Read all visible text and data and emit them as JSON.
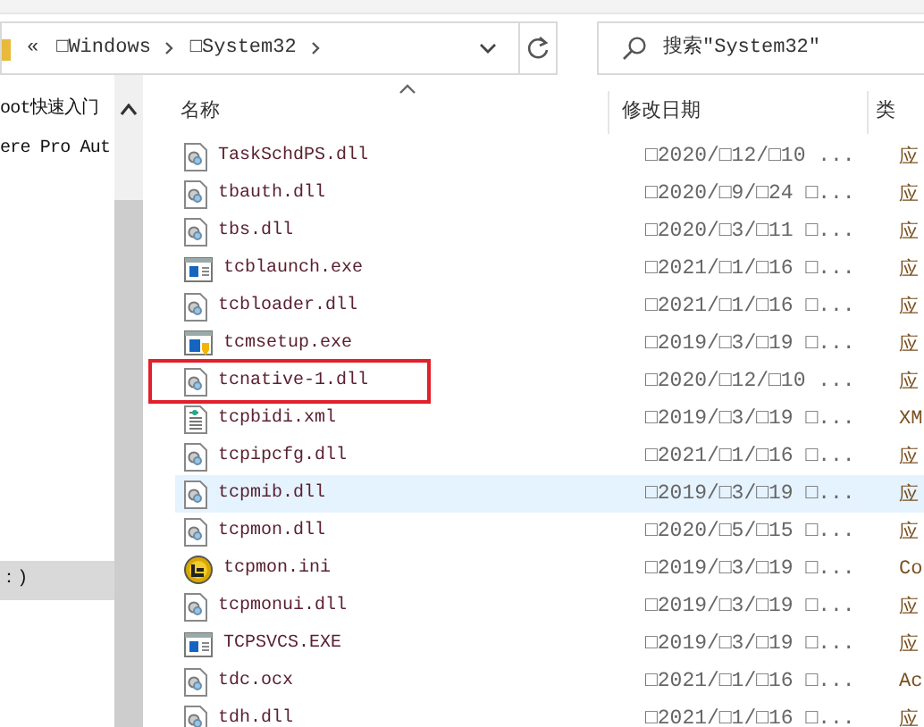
{
  "address_bar": {
    "overflow": "«",
    "segments": [
      "□Windows",
      "□System32"
    ]
  },
  "search": {
    "placeholder": "搜索\"System32\""
  },
  "sidebar": {
    "items": [
      {
        "label": "oot快速入门",
        "selected": false
      },
      {
        "label": "ere Pro Aut",
        "selected": false
      },
      {
        "label": "：)",
        "selected": true
      }
    ]
  },
  "table": {
    "columns": [
      "名称",
      "修改日期",
      "类"
    ],
    "rows": [
      {
        "kind": "dll",
        "name": "TaskSchdPS.dll",
        "date": "□2020/□12/□10 ...",
        "column_3": "应",
        "selected": false,
        "marked": false
      },
      {
        "kind": "dll",
        "name": "tbauth.dll",
        "date": "□2020/□9/□24 □...",
        "column_3": "应",
        "selected": false,
        "marked": false
      },
      {
        "kind": "dll",
        "name": "tbs.dll",
        "date": "□2020/□3/□11 □...",
        "column_3": "应",
        "selected": false,
        "marked": false
      },
      {
        "kind": "exe",
        "name": "tcblaunch.exe",
        "date": "□2021/□1/□16 □...",
        "column_3": "应",
        "selected": false,
        "marked": false
      },
      {
        "kind": "dll",
        "name": "tcbloader.dll",
        "date": "□2021/□1/□16 □...",
        "column_3": "应",
        "selected": false,
        "marked": false
      },
      {
        "kind": "setup",
        "name": "tcmsetup.exe",
        "date": "□2019/□3/□19 □...",
        "column_3": "应",
        "selected": false,
        "marked": false
      },
      {
        "kind": "dll",
        "name": "tcnative-1.dll",
        "date": "□2020/□12/□10 ...",
        "column_3": "应",
        "selected": false,
        "marked": true
      },
      {
        "kind": "xml",
        "name": "tcpbidi.xml",
        "date": "□2019/□3/□19 □...",
        "column_3": "XM",
        "selected": false,
        "marked": false
      },
      {
        "kind": "dll",
        "name": "tcpipcfg.dll",
        "date": "□2021/□1/□16 □...",
        "column_3": "应",
        "selected": false,
        "marked": false
      },
      {
        "kind": "dll",
        "name": "tcpmib.dll",
        "date": "□2019/□3/□19 □...",
        "column_3": "应",
        "selected": true,
        "marked": false
      },
      {
        "kind": "dll",
        "name": "tcpmon.dll",
        "date": "□2020/□5/□15 □...",
        "column_3": "应",
        "selected": false,
        "marked": false
      },
      {
        "kind": "ini",
        "name": "tcpmon.ini",
        "date": "□2019/□3/□19 □...",
        "column_3": "Co",
        "selected": false,
        "marked": false
      },
      {
        "kind": "dll",
        "name": "tcpmonui.dll",
        "date": "□2019/□3/□19 □...",
        "column_3": "应",
        "selected": false,
        "marked": false
      },
      {
        "kind": "exe",
        "name": "TCPSVCS.EXE",
        "date": "□2019/□3/□19 □...",
        "column_3": "应",
        "selected": false,
        "marked": false
      },
      {
        "kind": "dll",
        "name": "tdc.ocx",
        "date": "□2021/□1/□16 □...",
        "column_3": "Ac",
        "selected": false,
        "marked": false
      },
      {
        "kind": "dll",
        "name": "tdh.dll",
        "date": "□2021/□1/□16 □...",
        "column_3": "应",
        "selected": false,
        "marked": false
      }
    ]
  }
}
